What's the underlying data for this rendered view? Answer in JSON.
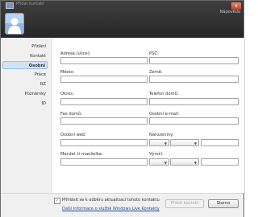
{
  "window": {
    "title": "Přidat kontakt",
    "close_glyph": "x",
    "help_link": "Nápověda"
  },
  "sidebar": {
    "items": [
      {
        "label": "Přidání",
        "active": false
      },
      {
        "label": "Kontakt",
        "active": false
      },
      {
        "label": "Osobní",
        "active": true
      },
      {
        "label": "Práce",
        "active": false
      },
      {
        "label": "RZ",
        "active": false
      },
      {
        "label": "Poznámky",
        "active": false
      },
      {
        "label": "ID",
        "active": false
      }
    ]
  },
  "form": {
    "street_label": "Adresa (ulice):",
    "zip_label": "PSČ:",
    "city_label": "Město:",
    "country_label": "Země:",
    "district_label": "Okres:",
    "home_phone_label": "Telefon domů:",
    "home_fax_label": "Fax domů:",
    "personal_email_label": "Osobní e-mail:",
    "personal_web_label": "Osobní web:",
    "birthday_label": "Narozeniny:",
    "spouse_label": "Manžel či manželka:",
    "anniversary_label": "Výročí:"
  },
  "footer": {
    "checkbox_checked": true,
    "checkbox_label": "Přihlásit se k odběru aktualizací tohoto kontaktu",
    "more_info_link": "Další informace o službě Windows Live Kontakty",
    "add_button": "Přidat kontakt",
    "cancel_button": "Storno"
  },
  "colors": {
    "titlebar": "#2f2f2f",
    "active_nav": "#cfe3f6",
    "link": "#1d4f99"
  },
  "icons": {
    "window": "contacts-window-icon",
    "avatar": "default-user-avatar"
  }
}
